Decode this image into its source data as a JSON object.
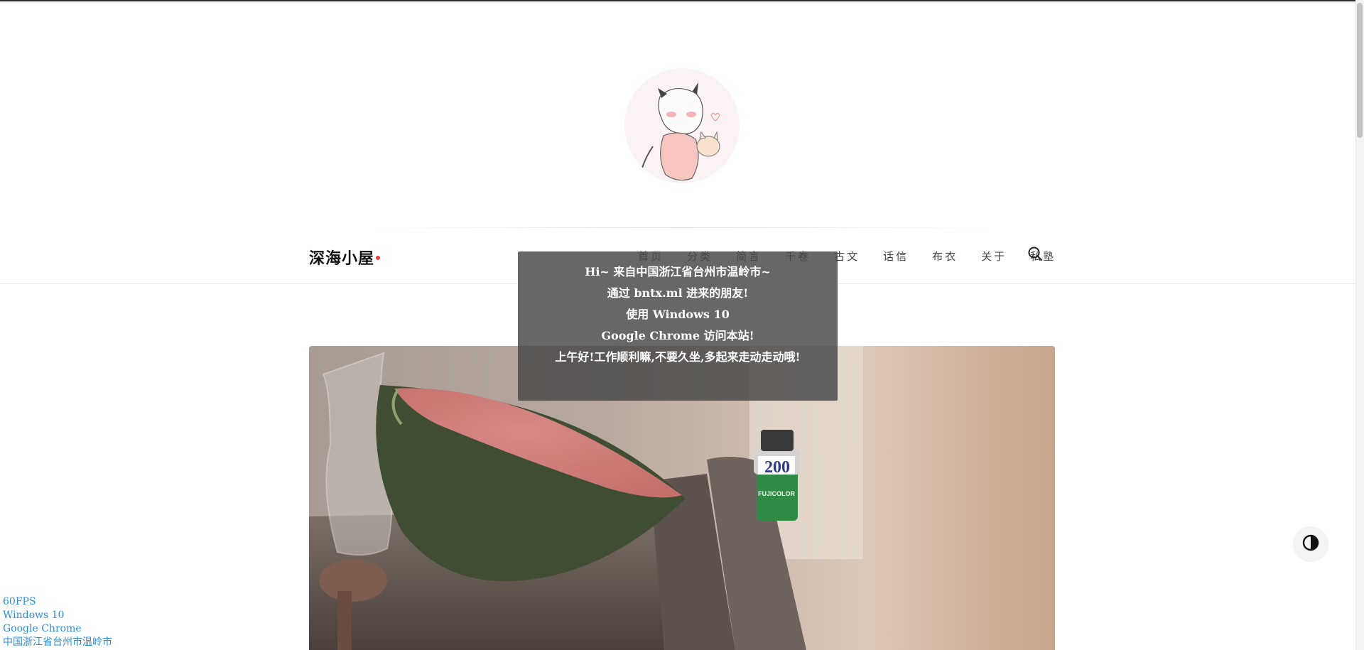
{
  "site": {
    "title": "深海小屋"
  },
  "nav": {
    "items": [
      {
        "label": "首页"
      },
      {
        "label": "分类"
      },
      {
        "label": "简言"
      },
      {
        "label": "千卷"
      },
      {
        "label": "古文"
      },
      {
        "label": "话信"
      },
      {
        "label": "布衣"
      },
      {
        "label": "关于"
      },
      {
        "label": "私塾"
      }
    ]
  },
  "popup": {
    "line1": "Hi~ 来自中国浙江省台州市温岭市~",
    "line2": "通过 bntx.ml 进来的朋友!",
    "line3": "使用 Windows 10",
    "line4": "Google Chrome 访问本站!",
    "line5": "上午好!工作顺利嘛,不要久坐,多起来走动走动哦!"
  },
  "hero": {
    "film_label": "200",
    "film_brand": "FUJICOLOR"
  },
  "debug": {
    "fps": "60FPS",
    "os": "Windows 10",
    "browser": "Google Chrome",
    "location": "中国浙江省台州市温岭市"
  },
  "colors": {
    "accent_dot": "#e8413b",
    "debug_text": "#2a8fd8",
    "popup_bg": "rgba(70,70,70,0.82)"
  },
  "icons": {
    "search": "search-icon",
    "theme": "contrast-icon"
  }
}
